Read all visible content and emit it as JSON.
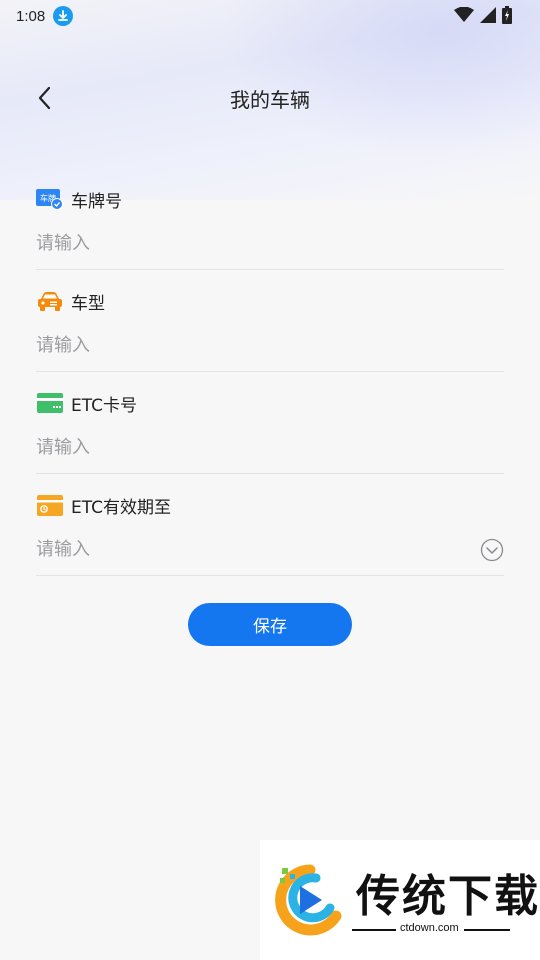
{
  "status_bar": {
    "time": "1:08"
  },
  "nav": {
    "title": "我的车辆"
  },
  "fields": [
    {
      "label": "车牌号",
      "placeholder": "请输入",
      "icon": "license-plate-icon"
    },
    {
      "label": "车型",
      "placeholder": "请输入",
      "icon": "car-icon"
    },
    {
      "label": "ETC卡号",
      "placeholder": "请输入",
      "icon": "etc-card-icon"
    },
    {
      "label": "ETC有效期至",
      "placeholder": "请输入",
      "icon": "etc-expiry-icon"
    }
  ],
  "plate_icon_text": "车牌",
  "save_label": "保存",
  "watermark": {
    "name": "传统下载",
    "domain": "ctdown.com"
  },
  "colors": {
    "primary": "#1477f0",
    "plate_blue": "#2e86f5",
    "car_orange": "#f5890a",
    "card_green": "#3fbf6a",
    "expiry_orange": "#f5a623"
  }
}
